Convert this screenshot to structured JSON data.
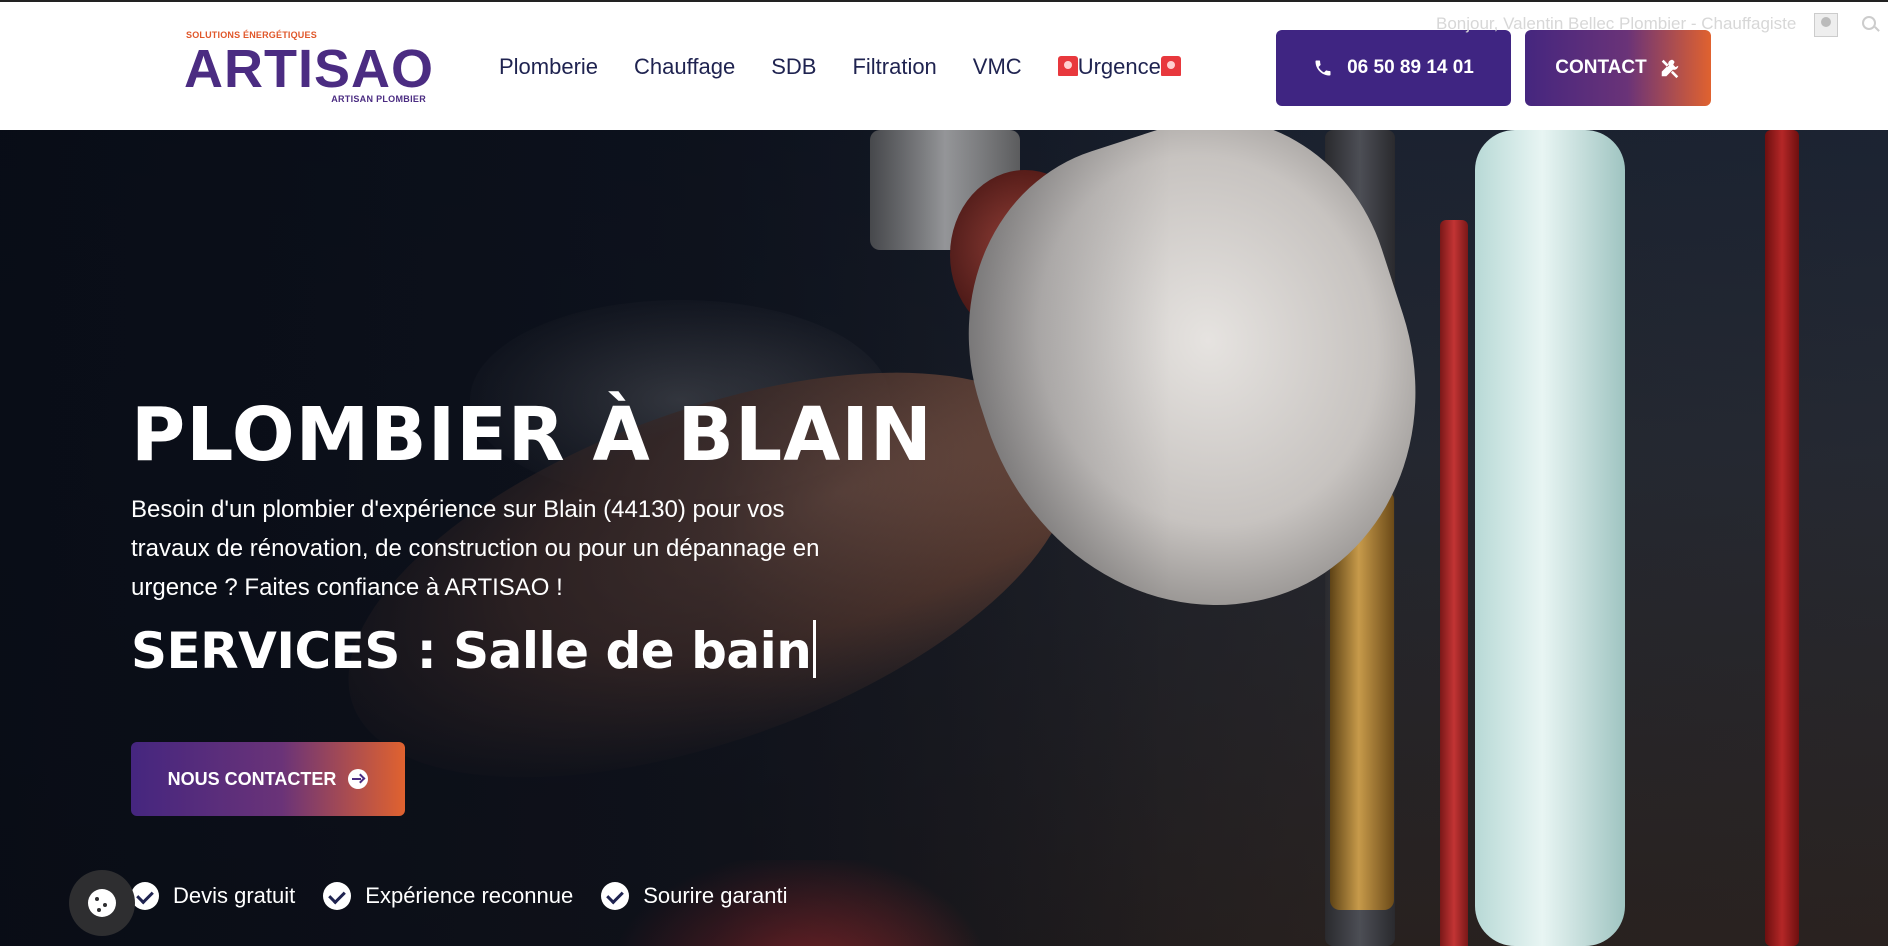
{
  "header": {
    "logo": {
      "tagline": "SOLUTIONS ÉNERGÉTIQUES",
      "wordmark": "ARTISAO",
      "subtitle": "ARTISAN PLOMBIER"
    },
    "nav": [
      {
        "label": "Plomberie"
      },
      {
        "label": "Chauffage"
      },
      {
        "label": "SDB"
      },
      {
        "label": "Filtration"
      },
      {
        "label": "VMC"
      },
      {
        "label": "Urgence"
      }
    ],
    "phone_button": {
      "label": "06 50 89 14 01",
      "icon": "phone-icon"
    },
    "contact_button": {
      "label": "CONTACT",
      "icon": "tools-icon"
    },
    "greeting": "Bonjour, Valentin Bellec Plombier - Chauffagiste"
  },
  "hero": {
    "title": "PLOMBIER À BLAIN",
    "description": "Besoin d'un plombier d'expérience sur Blain (44130) pour vos travaux de rénovation, de construction ou pour un dépannage en urgence ? Faites confiance à ARTISAO !",
    "services_prefix": "SERVICES : ",
    "services_typed": "Salle de bain",
    "cta_label": "NOUS CONTACTER",
    "badges": [
      {
        "label": "Devis gratuit"
      },
      {
        "label": "Expérience reconnue"
      },
      {
        "label": "Sourire garanti"
      }
    ]
  },
  "colors": {
    "brand_purple": "#3f2582",
    "brand_orange": "#e0622f",
    "nav_text": "#1f2350"
  }
}
